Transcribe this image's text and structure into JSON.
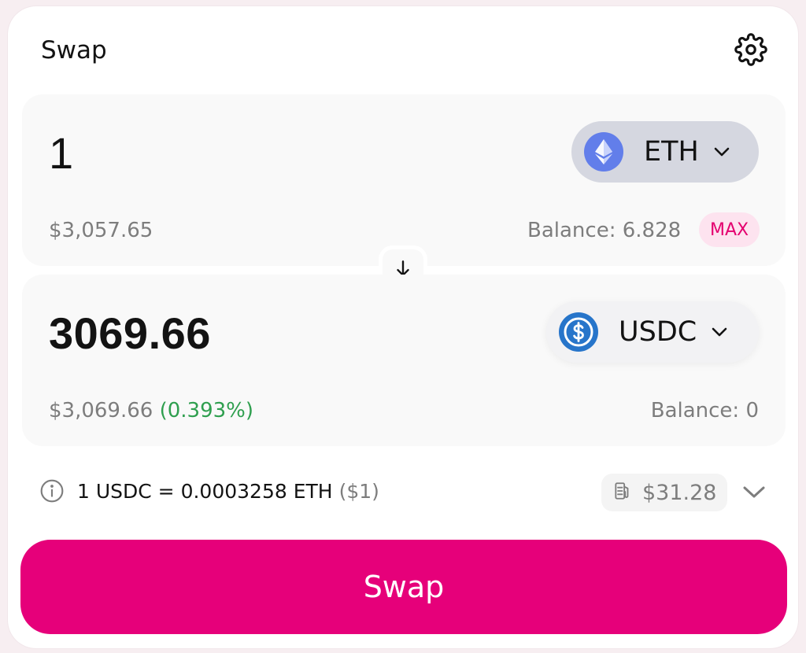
{
  "header": {
    "title": "Swap",
    "settings_icon": "gear-icon"
  },
  "sell": {
    "amount": "1",
    "usd_value": "$3,057.65",
    "token": {
      "symbol": "ETH",
      "icon": "ethereum-icon",
      "color": "#627eea"
    },
    "balance": "Balance: 6.828",
    "max_label": "MAX"
  },
  "switch": {
    "icon": "arrow-down-icon"
  },
  "buy": {
    "amount": "3069.66",
    "usd_value": "$3,069.66",
    "price_impact": "(0.393%)",
    "token": {
      "symbol": "USDC",
      "icon": "usdc-icon",
      "color": "#2775ca"
    },
    "balance": "Balance: 0"
  },
  "quote": {
    "info_icon": "info-icon",
    "rate": "1 USDC = 0.0003258 ETH",
    "rate_usd": "($1)",
    "gas_icon": "gas-pump-icon",
    "gas_fee": "$31.28"
  },
  "action": {
    "swap_label": "Swap",
    "accent_color": "#e6007a"
  }
}
